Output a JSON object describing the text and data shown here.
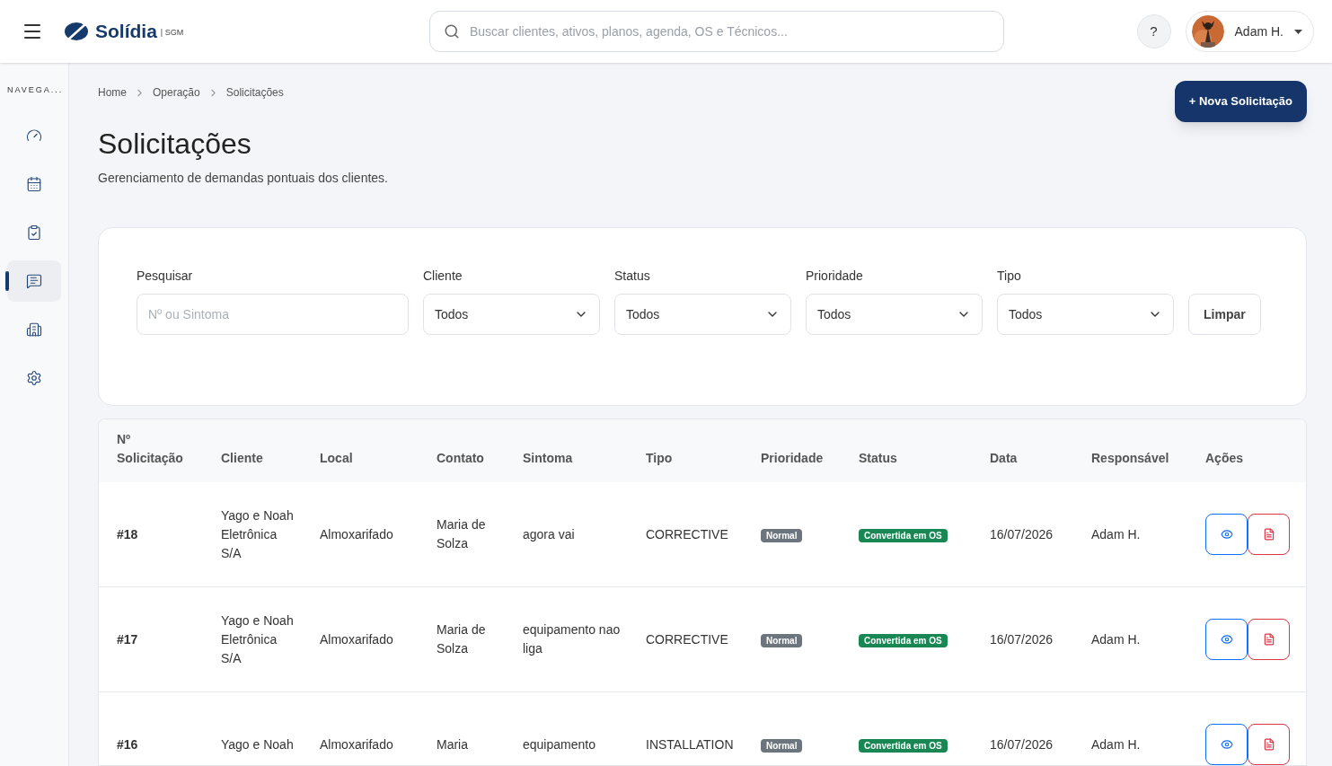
{
  "header": {
    "logo": "Solídia",
    "logo_suffix": "| SGM",
    "search": {
      "placeholder": "Buscar clientes, ativos, planos, agenda, OS e Técnicos..."
    },
    "help": "?",
    "user": {
      "name": "Adam H."
    }
  },
  "sidebar": {
    "title": "NAVEGA...",
    "items": [
      {
        "kind": "gauge",
        "selected": false
      },
      {
        "kind": "calendar",
        "selected": false
      },
      {
        "kind": "clipboard",
        "selected": false
      },
      {
        "kind": "message",
        "selected": true
      },
      {
        "kind": "building",
        "selected": false
      },
      {
        "kind": "settings",
        "selected": false
      }
    ]
  },
  "breadcrumb": [
    "Home",
    "Operação",
    "Solicitações"
  ],
  "page": {
    "title": "Solicitações",
    "subtitle": "Gerenciamento de demandas pontuais dos clientes.",
    "new_button": "+ Nova Solicitação"
  },
  "filters": {
    "search": {
      "label": "Pesquisar",
      "placeholder": "Nº ou Sintoma"
    },
    "selects": [
      {
        "label": "Cliente",
        "value": "Todos"
      },
      {
        "label": "Status",
        "value": "Todos"
      },
      {
        "label": "Prioridade",
        "value": "Todos"
      },
      {
        "label": "Tipo",
        "value": "Todos"
      }
    ],
    "clear_button": "Limpar"
  },
  "table": {
    "columns": [
      "Nº Solicitação",
      "Cliente",
      "Local",
      "Contato",
      "Sintoma",
      "Tipo",
      "Prioridade",
      "Status",
      "Data",
      "Responsável",
      "Ações"
    ],
    "rows": [
      {
        "number": "#18",
        "client": "Yago e Noah Eletrônica S/A",
        "local": "Almoxarifado",
        "contact": "Maria de Solza",
        "symptom": "agora vai",
        "type": "CORRECTIVE",
        "priority": {
          "label": "Normal",
          "color": "#6c757d"
        },
        "status": {
          "label": "Convertida em OS",
          "color": "#198754"
        },
        "date": "16/07/2026",
        "responsible": "Adam H."
      },
      {
        "number": "#17",
        "client": "Yago e Noah Eletrônica S/A",
        "local": "Almoxarifado",
        "contact": "Maria de Solza",
        "symptom": "equipamento nao liga",
        "type": "CORRECTIVE",
        "priority": {
          "label": "Normal",
          "color": "#6c757d"
        },
        "status": {
          "label": "Convertida em OS",
          "color": "#198754"
        },
        "date": "16/07/2026",
        "responsible": "Adam H."
      },
      {
        "number": "#16",
        "client": "Yago e Noah",
        "local": "Almoxarifado",
        "contact": "Maria",
        "symptom": "equipamento",
        "type": "INSTALLATION",
        "priority": {
          "label": "Normal",
          "color": "#6c757d"
        },
        "status": {
          "label": "Convertida em OS",
          "color": "#198754"
        },
        "date": "16/07/2026",
        "responsible": "Adam H."
      }
    ]
  }
}
